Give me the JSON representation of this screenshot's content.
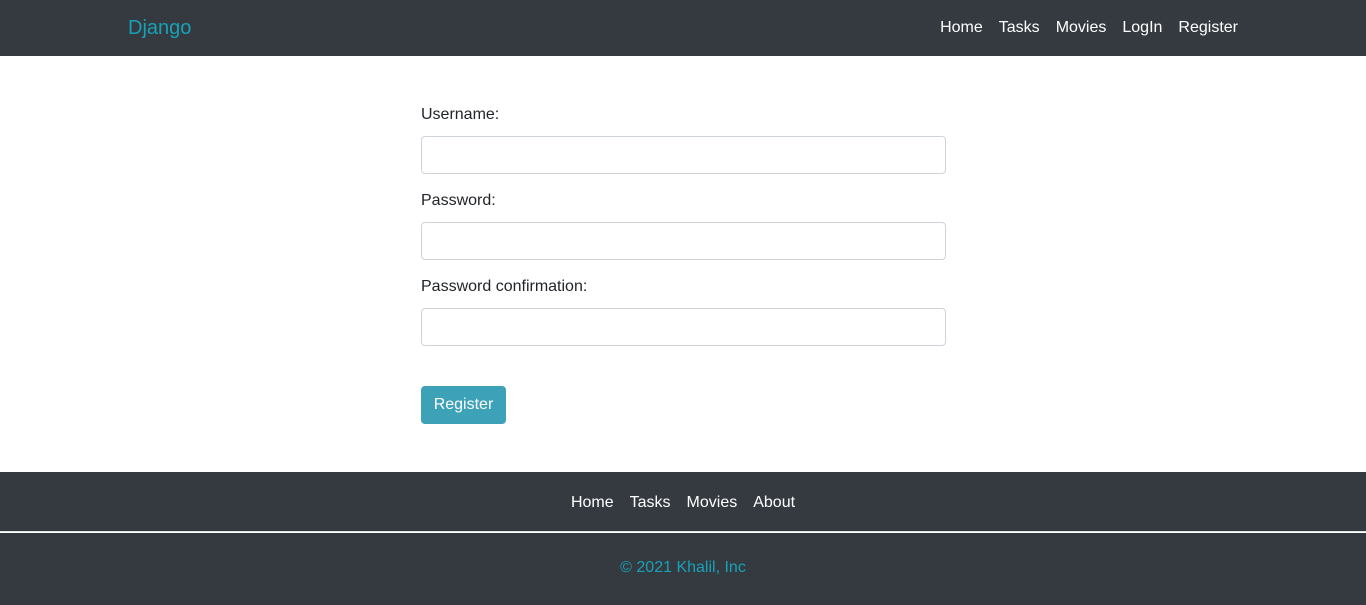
{
  "navbar": {
    "brand": "Django",
    "links": [
      "Home",
      "Tasks",
      "Movies",
      "LogIn",
      "Register"
    ]
  },
  "form": {
    "username_label": "Username:",
    "username_value": "",
    "password_label": "Password:",
    "password_value": "",
    "password_confirm_label": "Password confirmation:",
    "password_confirm_value": "",
    "submit_label": "Register"
  },
  "footer": {
    "links": [
      "Home",
      "Tasks",
      "Movies",
      "About"
    ],
    "copyright": "© 2021 Khalil, Inc"
  },
  "colors": {
    "navbar_bg": "#343a40",
    "brand": "#17a2b8",
    "button": "#3da2b8"
  }
}
